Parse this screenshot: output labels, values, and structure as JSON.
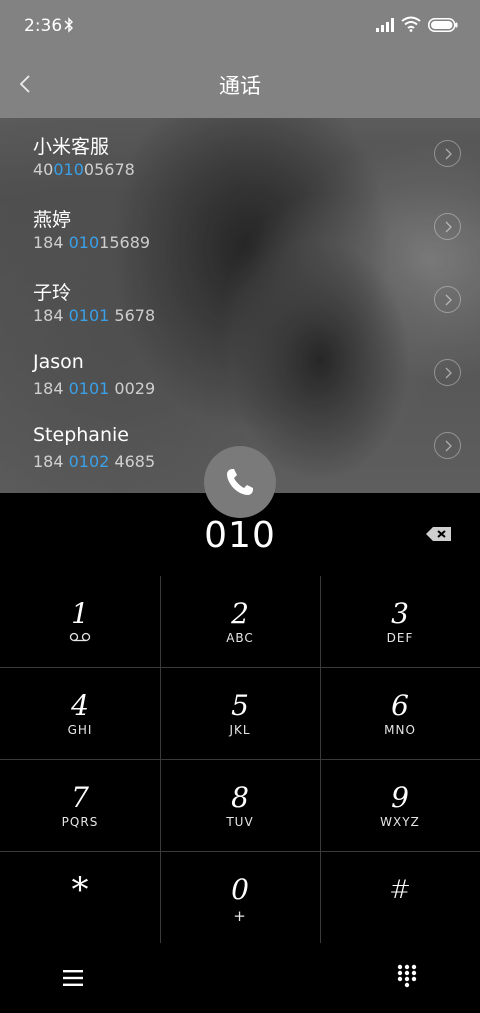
{
  "status_bar": {
    "time": "2:36"
  },
  "header": {
    "title": "通话"
  },
  "contacts": [
    {
      "name": "小米客服",
      "number_parts": [
        "40",
        "010",
        "05678"
      ]
    },
    {
      "name": "燕婷",
      "number_parts": [
        "184 ",
        "010",
        "15689"
      ]
    },
    {
      "name": "子玲",
      "number_parts": [
        "184 ",
        "0101",
        " 5678"
      ]
    },
    {
      "name": "Jason",
      "number_parts": [
        "184 ",
        "0101",
        " 0029"
      ]
    },
    {
      "name": "Stephanie",
      "number_parts": [
        "184 ",
        "0102",
        " 4685"
      ]
    }
  ],
  "dialer": {
    "input": "010",
    "keys": [
      {
        "digit": "1",
        "letters": ""
      },
      {
        "digit": "2",
        "letters": "ABC"
      },
      {
        "digit": "3",
        "letters": "DEF"
      },
      {
        "digit": "4",
        "letters": "GHI"
      },
      {
        "digit": "5",
        "letters": "JKL"
      },
      {
        "digit": "6",
        "letters": "MNO"
      },
      {
        "digit": "7",
        "letters": "PQRS"
      },
      {
        "digit": "8",
        "letters": "TUV"
      },
      {
        "digit": "9",
        "letters": "WXYZ"
      },
      {
        "digit": "*",
        "letters": ""
      },
      {
        "digit": "0",
        "letters": "+"
      },
      {
        "digit": "#",
        "letters": ""
      }
    ]
  },
  "colors": {
    "highlight": "#3aa0e8",
    "call_button": "#7a7a7a",
    "header": "#828282"
  }
}
